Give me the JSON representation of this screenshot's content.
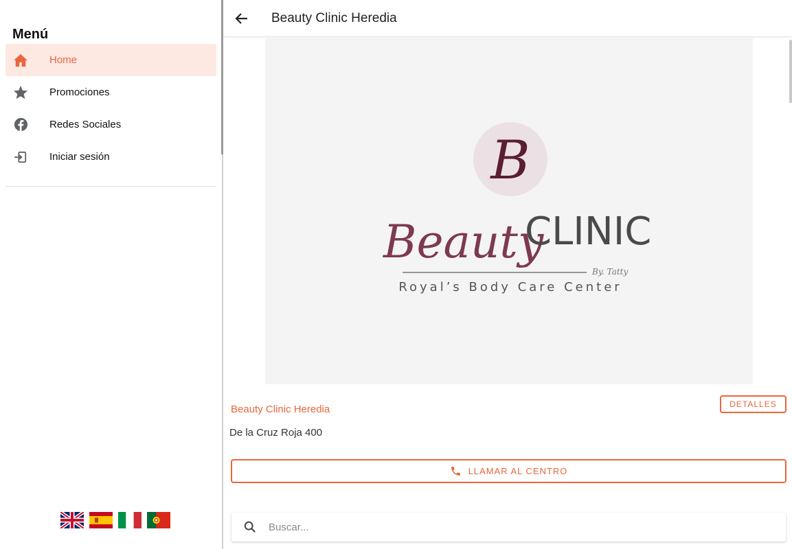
{
  "sidebar": {
    "title": "Menú",
    "items": [
      {
        "label": "Home",
        "icon": "home-icon",
        "active": true
      },
      {
        "label": "Promociones",
        "icon": "star-icon"
      },
      {
        "label": "Redes Sociales",
        "icon": "facebook-icon"
      },
      {
        "label": "Iniciar sesión",
        "icon": "login-icon"
      }
    ],
    "languages": [
      "english-flag",
      "spanish-flag",
      "italian-flag",
      "portuguese-flag"
    ]
  },
  "header": {
    "back_icon": "arrow-left-icon",
    "title": "Beauty Clinic Heredia"
  },
  "hero": {
    "logo_monogram": "B",
    "logo_script": "Beauty",
    "logo_word": "CLINIC",
    "logo_byline": "By. Tatty",
    "logo_tagline": "Royal’s Body Care Center"
  },
  "center": {
    "name": "Beauty Clinic Heredia",
    "address": "De la Cruz Roja 400",
    "details_label": "DETALLES",
    "call_label": "LLAMAR AL CENTRO"
  },
  "search": {
    "placeholder": "Buscar..."
  },
  "colors": {
    "accent": "#e8663e",
    "active_bg": "#fde8e2",
    "icon_gray": "#5f6368"
  }
}
